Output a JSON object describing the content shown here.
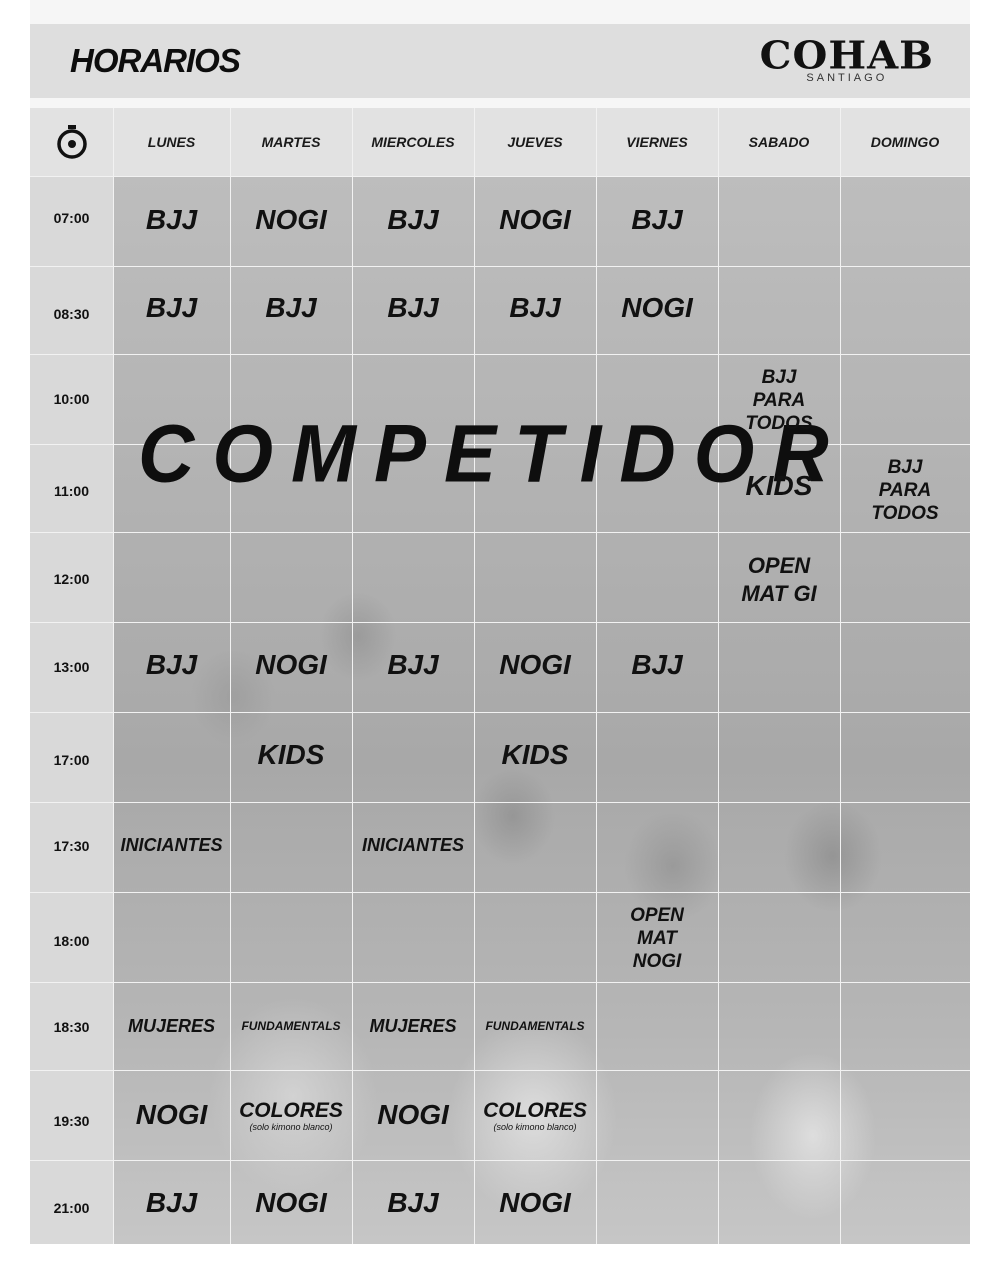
{
  "header": {
    "title": "HORARIOS",
    "logo_main": "COHAB",
    "logo_sub": "SANTIAGO"
  },
  "days": [
    "LUNES",
    "MARTES",
    "MIERCOLES",
    "JUEVES",
    "VIERNES",
    "SABADO",
    "DOMINGO"
  ],
  "times": [
    "07:00",
    "08:30",
    "10:00",
    "11:00",
    "12:00",
    "13:00",
    "17:00",
    "17:30",
    "18:00",
    "18:30",
    "19:30",
    "21:00"
  ],
  "icons": {
    "clock": "stopwatch-icon"
  },
  "classes": {
    "r0700": [
      "BJJ",
      "NOGI",
      "BJJ",
      "NOGI",
      "BJJ"
    ],
    "r0830": [
      "BJJ",
      "BJJ",
      "BJJ",
      "BJJ",
      "NOGI"
    ],
    "competidor": "COMPETIDOR",
    "sat_1000": [
      "BJJ",
      "PARA",
      "TODOS"
    ],
    "sat_1100": "KIDS",
    "sun_1100": [
      "BJJ",
      "PARA",
      "TODOS"
    ],
    "sat_1200": [
      "OPEN",
      "MAT GI"
    ],
    "r1300": [
      "BJJ",
      "NOGI",
      "BJJ",
      "NOGI",
      "BJJ"
    ],
    "r1700": [
      "KIDS",
      "KIDS"
    ],
    "r1730": [
      "INICIANTES",
      "INICIANTES"
    ],
    "fri_1800": [
      "OPEN",
      "MAT",
      "NOGI"
    ],
    "r1830": [
      "MUJERES",
      "FUNDAMENTALS",
      "MUJERES",
      "FUNDAMENTALS"
    ],
    "r1930": [
      "NOGI",
      "COLORES",
      "NOGI",
      "COLORES"
    ],
    "colores_note": "(solo kimono blanco)",
    "r2100": [
      "BJJ",
      "NOGI",
      "BJJ",
      "NOGI"
    ]
  }
}
